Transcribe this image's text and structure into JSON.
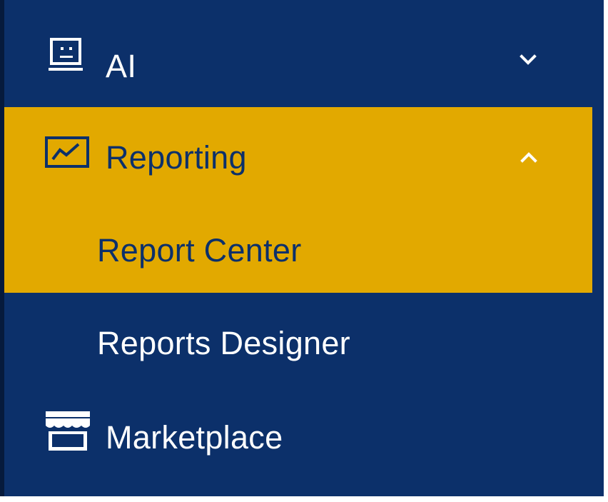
{
  "sidebar": {
    "items": [
      {
        "label": "AI",
        "icon": "robot-icon",
        "state": "collapsed",
        "chevron": "chevron-down-icon"
      },
      {
        "label": "Reporting",
        "icon": "chart-line-icon",
        "state": "expanded",
        "chevron": "chevron-up-icon",
        "children": [
          {
            "label": "Report Center",
            "active": true
          },
          {
            "label": "Reports Designer",
            "active": false
          }
        ]
      },
      {
        "label": "Marketplace",
        "icon": "storefront-icon"
      }
    ]
  },
  "colors": {
    "sidebar_bg": "#0c306a",
    "active_bg": "#e2a900",
    "text_light": "#ffffff",
    "text_dark": "#0c306a"
  }
}
